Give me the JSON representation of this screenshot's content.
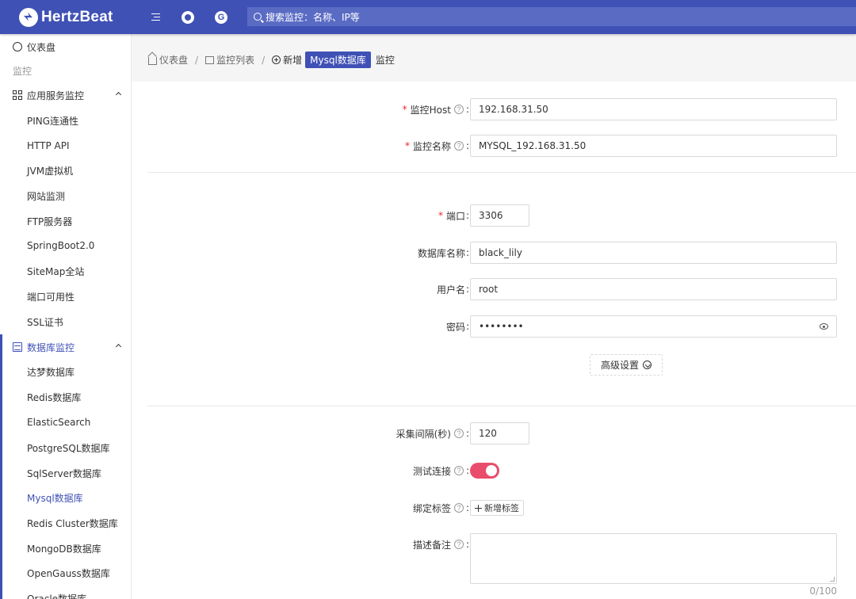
{
  "header": {
    "brand": "HertzBeat",
    "search_placeholder": "搜索监控：名称、IP等",
    "accent_color": "#3f51b5",
    "icons": [
      "menu-fold-icon",
      "github-icon",
      "gitee-icon",
      "search-icon"
    ]
  },
  "sidebar": {
    "dashboard": "仪表盘",
    "group_label": "监控",
    "app_group": "应用服务监控",
    "app_items": [
      "PING连通性",
      "HTTP API",
      "JVM虚拟机",
      "网站监测",
      "FTP服务器",
      "SpringBoot2.0",
      "SiteMap全站",
      "端口可用性",
      "SSL证书"
    ],
    "db_group": "数据库监控",
    "db_items": [
      "达梦数据库",
      "Redis数据库",
      "ElasticSearch",
      "PostgreSQL数据库",
      "SqlServer数据库",
      "Mysql数据库",
      "Redis Cluster数据库",
      "MongoDB数据库",
      "OpenGauss数据库",
      "Oracle数据库"
    ],
    "active_item": "Mysql数据库"
  },
  "breadcrumb": {
    "home": "仪表盘",
    "list": "监控列表",
    "new": "新增",
    "type_tag": "Mysql数据库",
    "suffix": "监控"
  },
  "form": {
    "host": {
      "label": "监控Host",
      "value": "192.168.31.50"
    },
    "name": {
      "label": "监控名称",
      "value": "MYSQL_192.168.31.50"
    },
    "port": {
      "label": "端口",
      "value": "3306"
    },
    "database": {
      "label": "数据库名称",
      "value": "black_lily"
    },
    "username": {
      "label": "用户名",
      "value": "root"
    },
    "password": {
      "label": "密码",
      "value": "••••••••"
    },
    "advanced_button": "高级设置",
    "interval": {
      "label": "采集间隔(秒)",
      "value": "120"
    },
    "test_connection": {
      "label": "测试连接",
      "enabled": true,
      "color": "#ea4c6b"
    },
    "tags": {
      "label": "绑定标签",
      "add_button": "新增标签"
    },
    "description": {
      "label": "描述备注",
      "value": "",
      "counter": "0/100"
    }
  }
}
